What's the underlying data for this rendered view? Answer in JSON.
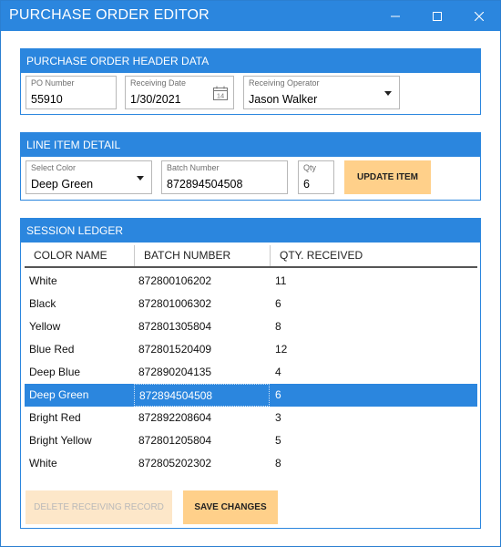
{
  "window": {
    "title": "PURCHASE ORDER EDITOR"
  },
  "header_section": {
    "title": "PURCHASE ORDER HEADER DATA",
    "po_number_label": "PO Number",
    "po_number_value": "55910",
    "receiving_date_label": "Receiving Date",
    "receiving_date_value": "1/30/2021",
    "calendar_day": "14",
    "operator_label": "Receiving Operator",
    "operator_value": "Jason Walker"
  },
  "line_item": {
    "title": "LINE ITEM DETAIL",
    "color_label": "Select Color",
    "color_value": "Deep Green",
    "batch_label": "Batch Number",
    "batch_value": "872894504508",
    "qty_label": "Qty",
    "qty_value": "6",
    "update_button": "UPDATE ITEM"
  },
  "ledger": {
    "title": "SESSION LEDGER",
    "columns": [
      "COLOR NAME",
      "BATCH NUMBER",
      "QTY. RECEIVED"
    ],
    "rows": [
      {
        "color": "White",
        "batch": "872800106202",
        "qty": "11"
      },
      {
        "color": "Black",
        "batch": "872801006302",
        "qty": "6"
      },
      {
        "color": "Yellow",
        "batch": "872801305804",
        "qty": "8"
      },
      {
        "color": "Blue Red",
        "batch": "872801520409",
        "qty": "12"
      },
      {
        "color": "Deep Blue",
        "batch": "872890204135",
        "qty": "4"
      },
      {
        "color": "Deep Green",
        "batch": "872894504508",
        "qty": "6"
      },
      {
        "color": "Bright Red",
        "batch": "872892208604",
        "qty": "3"
      },
      {
        "color": "Bright Yellow",
        "batch": "872801205804",
        "qty": "5"
      },
      {
        "color": "White",
        "batch": "872805202302",
        "qty": "8"
      }
    ],
    "selected_index": 5,
    "delete_button": "DELETE RECEIVING RECORD",
    "save_button": "SAVE CHANGES"
  },
  "colors": {
    "accent": "#2b86de",
    "button": "#ffd08a",
    "button_disabled": "#fde7c9"
  }
}
